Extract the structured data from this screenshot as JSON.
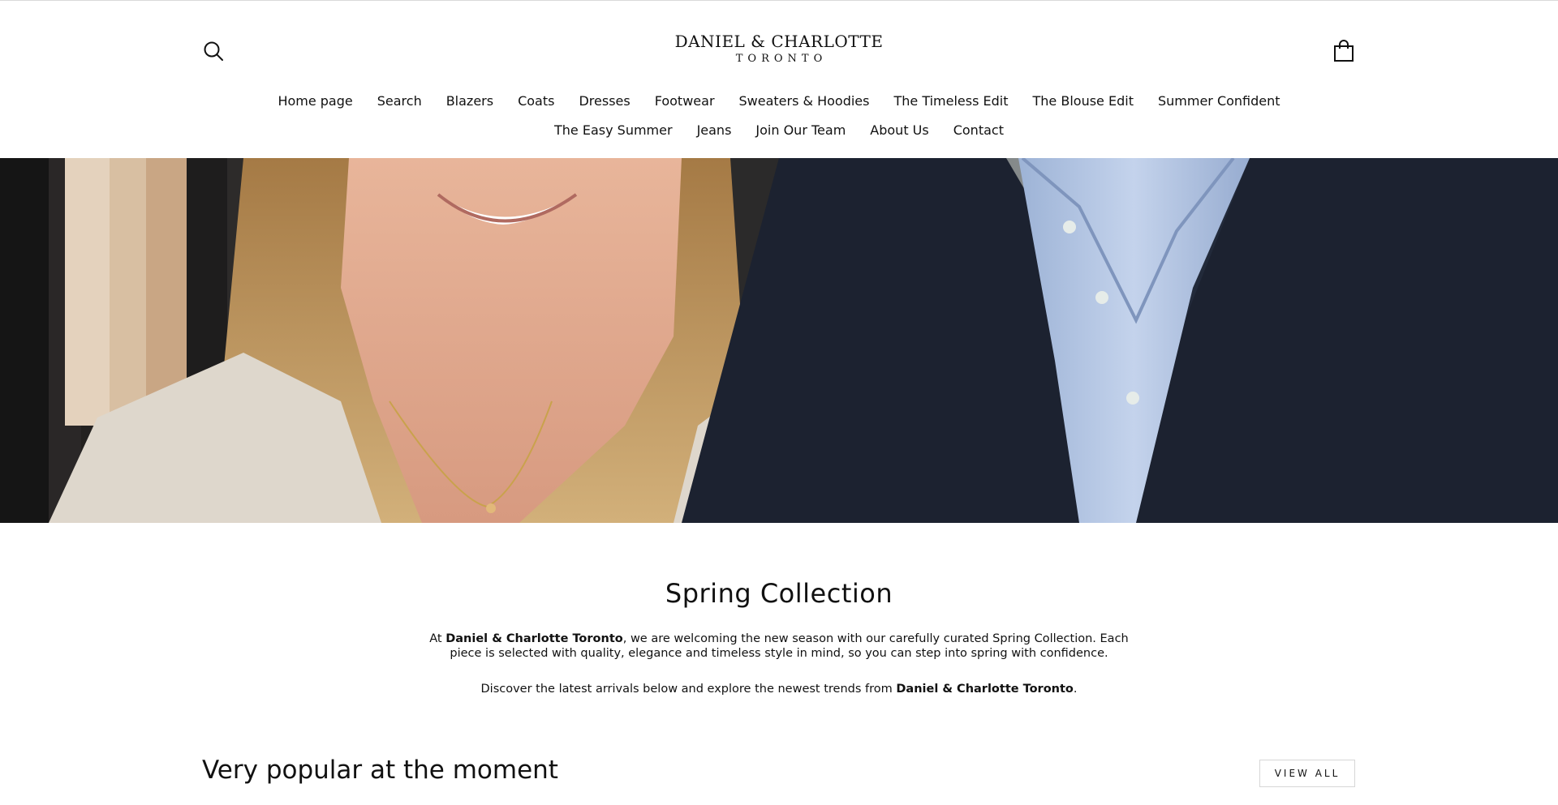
{
  "header": {
    "logo_brand": "DANIEL & CHARLOTTE",
    "logo_city": "TORONTO"
  },
  "nav": {
    "row1": [
      "Home page",
      "Search",
      "Blazers",
      "Coats",
      "Dresses",
      "Footwear",
      "Sweaters & Hoodies",
      "The Timeless Edit",
      "The Blouse Edit",
      "Summer Confident"
    ],
    "row2": [
      "The Easy Summer",
      "Jeans",
      "Join Our Team",
      "About Us",
      "Contact"
    ]
  },
  "intro": {
    "title": "Spring Collection",
    "p1_prefix": "At ",
    "p1_brand": "Daniel & Charlotte Toronto",
    "p1_rest": ", we are welcoming the new season with our carefully curated Spring Collection. Each piece is selected with quality, elegance and timeless style in mind, so you can step into spring with confidence.",
    "p2_prefix": "Discover the latest arrivals below and explore the newest trends from ",
    "p2_brand": "Daniel & Charlotte Toronto",
    "p2_suffix": "."
  },
  "popular": {
    "title": "Very popular at the moment",
    "view_all_label": "VIEW ALL"
  },
  "icons": {
    "search": "search-icon",
    "cart": "shopping-bag-icon"
  }
}
